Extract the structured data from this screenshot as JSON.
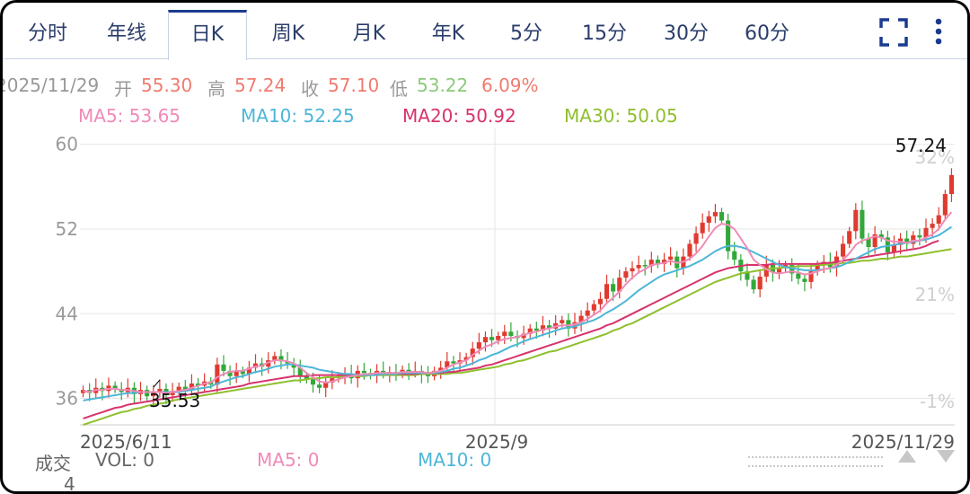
{
  "tabs": [
    "分时",
    "年线",
    "日K",
    "周K",
    "月K",
    "年K",
    "5分",
    "15分",
    "30分",
    "60分"
  ],
  "active_tab": "日K",
  "controls": {
    "fullscreen_icon": "fullscreen-icon",
    "more_icon": "more-vertical-icon"
  },
  "ohlc": {
    "date": "2025/11/29",
    "open_label": "开",
    "open": "55.30",
    "high_label": "高",
    "high": "57.24",
    "close_label": "收",
    "close": "57.10",
    "low_label": "低",
    "low": "53.22",
    "change": "6.09%"
  },
  "ma_legend": [
    {
      "label": "MA5: 53.65",
      "color": "#f08bb8"
    },
    {
      "label": "MA10: 52.25",
      "color": "#4db6d8"
    },
    {
      "label": "MA20: 50.92",
      "color": "#d8336d"
    },
    {
      "label": "MA30: 50.05",
      "color": "#8fbf2e"
    }
  ],
  "volume_legend": {
    "title": "成交",
    "vol": "VOL: 0",
    "ma5": "MA5: 0",
    "ma10": "MA10: 0",
    "axis_value": "4"
  },
  "colors": {
    "up": "#e03a2f",
    "down": "#33a83a",
    "grid": "#e6e6e6",
    "axis_text": "#9a9a9a",
    "tab_text": "#2a3d6b"
  },
  "chart_data": {
    "type": "candlestick",
    "y_ticks": [
      "60",
      "52",
      "44",
      "36"
    ],
    "y_tick_values": [
      60,
      52,
      44,
      36
    ],
    "pct_ticks": [
      "32%",
      "21%",
      "-1%"
    ],
    "pct_tick_values": [
      58.8,
      45.8,
      35.7
    ],
    "x_ticks": [
      "2025/6/11",
      "2025/9",
      "2025/11/29"
    ],
    "ylim": [
      33.5,
      61.5
    ],
    "high_annotation": "57.24",
    "low_annotation": "35.53",
    "closes": [
      36.8,
      36.5,
      37.0,
      36.7,
      37.2,
      36.9,
      36.6,
      37.0,
      36.4,
      36.8,
      36.2,
      36.6,
      36.9,
      36.3,
      36.7,
      37.1,
      36.8,
      37.4,
      37.2,
      37.6,
      37.3,
      39.2,
      38.6,
      38.1,
      38.6,
      38.3,
      38.9,
      39.3,
      39.0,
      39.6,
      40.0,
      39.5,
      39.3,
      38.9,
      38.1,
      37.8,
      37.3,
      37.0,
      37.5,
      37.9,
      38.1,
      38.3,
      37.9,
      38.6,
      38.4,
      38.2,
      38.6,
      38.4,
      38.5,
      38.3,
      38.7,
      38.5,
      38.6,
      38.3,
      38.1,
      38.6,
      38.9,
      39.5,
      39.3,
      39.6,
      39.9,
      40.7,
      41.3,
      41.8,
      41.5,
      41.9,
      42.3,
      41.9,
      41.7,
      42.1,
      42.6,
      42.4,
      42.9,
      42.6,
      43.1,
      43.4,
      42.6,
      43.2,
      43.8,
      44.3,
      44.9,
      45.4,
      46.8,
      46.1,
      47.4,
      48.0,
      48.3,
      48.6,
      48.5,
      49.1,
      48.7,
      49.1,
      49.4,
      48.3,
      49.4,
      50.6,
      51.6,
      52.6,
      53.2,
      53.6,
      52.8,
      49.9,
      49.1,
      48.0,
      47.2,
      46.3,
      47.5,
      48.6,
      47.9,
      48.3,
      48.6,
      47.8,
      47.3,
      47.0,
      48.0,
      48.6,
      48.9,
      48.4,
      49.4,
      50.6,
      51.8,
      53.8,
      51.1,
      50.3,
      51.5,
      51.2,
      49.8,
      50.5,
      51.1,
      50.6,
      51.4,
      51.2,
      52.1,
      52.5,
      53.3,
      55.3,
      57.1
    ],
    "ma5": [
      36.7,
      36.6,
      36.8,
      36.8,
      36.9,
      36.9,
      36.8,
      36.8,
      36.7,
      36.6,
      36.6,
      36.6,
      36.6,
      36.5,
      36.6,
      36.7,
      36.8,
      37.0,
      37.2,
      37.4,
      37.5,
      38.0,
      38.3,
      38.5,
      38.6,
      38.6,
      38.8,
      39.0,
      39.1,
      39.4,
      39.6,
      39.6,
      39.5,
      39.3,
      38.9,
      38.4,
      38.0,
      37.6,
      37.5,
      37.6,
      37.8,
      38.0,
      38.1,
      38.2,
      38.3,
      38.3,
      38.4,
      38.4,
      38.4,
      38.4,
      38.5,
      38.5,
      38.5,
      38.5,
      38.4,
      38.5,
      38.6,
      38.9,
      39.2,
      39.4,
      39.6,
      40.1,
      40.5,
      40.9,
      41.1,
      41.4,
      41.6,
      41.7,
      41.8,
      42.0,
      42.2,
      42.3,
      42.5,
      42.6,
      42.8,
      42.9,
      42.9,
      43.0,
      43.2,
      43.5,
      43.9,
      44.3,
      45.0,
      45.5,
      46.1,
      46.8,
      47.4,
      47.9,
      48.2,
      48.6,
      48.7,
      48.8,
      49.0,
      48.8,
      48.9,
      49.2,
      49.7,
      50.4,
      51.3,
      52.1,
      52.5,
      52.4,
      52.0,
      51.1,
      50.2,
      49.1,
      48.6,
      48.2,
      47.9,
      47.8,
      47.9,
      48.0,
      47.9,
      47.7,
      47.8,
      48.0,
      48.2,
      48.3,
      48.6,
      49.1,
      49.7,
      50.5,
      50.9,
      51.1,
      51.3,
      51.2,
      50.9,
      50.8,
      50.8,
      50.7,
      50.9,
      50.9,
      51.2,
      51.5,
      52.0,
      52.9,
      53.6
    ],
    "ma10": [
      35.8,
      35.9,
      36.0,
      36.1,
      36.2,
      36.3,
      36.4,
      36.5,
      36.5,
      36.6,
      36.6,
      36.6,
      36.6,
      36.6,
      36.6,
      36.6,
      36.7,
      36.8,
      36.9,
      37.0,
      37.1,
      37.4,
      37.6,
      37.8,
      38.0,
      38.1,
      38.3,
      38.5,
      38.6,
      38.8,
      39.0,
      39.1,
      39.2,
      39.2,
      39.1,
      39.0,
      38.9,
      38.7,
      38.6,
      38.5,
      38.4,
      38.3,
      38.3,
      38.2,
      38.2,
      38.2,
      38.2,
      38.3,
      38.3,
      38.3,
      38.4,
      38.4,
      38.4,
      38.4,
      38.4,
      38.4,
      38.5,
      38.6,
      38.8,
      38.9,
      39.1,
      39.3,
      39.6,
      39.8,
      40.1,
      40.3,
      40.6,
      40.9,
      41.1,
      41.4,
      41.6,
      41.8,
      42.0,
      42.2,
      42.4,
      42.6,
      42.7,
      42.8,
      43.0,
      43.2,
      43.4,
      43.7,
      44.1,
      44.4,
      44.8,
      45.2,
      45.7,
      46.2,
      46.6,
      47.0,
      47.4,
      47.7,
      47.9,
      48.1,
      48.3,
      48.5,
      48.8,
      49.1,
      49.5,
      49.9,
      50.2,
      50.4,
      50.4,
      50.3,
      50.1,
      49.8,
      49.5,
      49.2,
      48.9,
      48.6,
      48.4,
      48.3,
      48.2,
      48.1,
      48.1,
      48.1,
      48.2,
      48.3,
      48.4,
      48.6,
      48.9,
      49.2,
      49.5,
      49.8,
      50.1,
      50.3,
      50.4,
      50.5,
      50.6,
      50.7,
      50.8,
      50.9,
      51.0,
      51.2,
      51.4,
      51.8,
      52.2
    ],
    "ma20": [
      34.1,
      34.3,
      34.5,
      34.7,
      34.9,
      35.1,
      35.2,
      35.4,
      35.5,
      35.6,
      35.7,
      35.8,
      35.9,
      36.0,
      36.1,
      36.2,
      36.3,
      36.4,
      36.5,
      36.6,
      36.7,
      36.8,
      36.9,
      37.0,
      37.1,
      37.2,
      37.4,
      37.5,
      37.6,
      37.7,
      37.8,
      37.9,
      38.0,
      38.1,
      38.1,
      38.1,
      38.2,
      38.2,
      38.2,
      38.2,
      38.2,
      38.2,
      38.2,
      38.2,
      38.2,
      38.3,
      38.3,
      38.3,
      38.3,
      38.3,
      38.3,
      38.3,
      38.3,
      38.4,
      38.4,
      38.4,
      38.4,
      38.5,
      38.5,
      38.6,
      38.7,
      38.8,
      38.9,
      39.1,
      39.2,
      39.4,
      39.6,
      39.8,
      40.0,
      40.2,
      40.4,
      40.6,
      40.8,
      41.0,
      41.2,
      41.4,
      41.6,
      41.8,
      42.0,
      42.2,
      42.4,
      42.6,
      42.9,
      43.1,
      43.4,
      43.7,
      44.0,
      44.3,
      44.6,
      44.9,
      45.2,
      45.5,
      45.8,
      46.1,
      46.4,
      46.7,
      47.0,
      47.3,
      47.6,
      47.9,
      48.1,
      48.3,
      48.4,
      48.5,
      48.6,
      48.6,
      48.6,
      48.6,
      48.7,
      48.7,
      48.7,
      48.7,
      48.7,
      48.7,
      48.7,
      48.7,
      48.8,
      48.8,
      48.9,
      49.0,
      49.1,
      49.2,
      49.3,
      49.4,
      49.5,
      49.6,
      49.7,
      49.8,
      49.9,
      50.0,
      50.1,
      50.2,
      50.4,
      50.7,
      50.9
    ],
    "ma30": [
      33.5,
      33.7,
      33.9,
      34.1,
      34.3,
      34.5,
      34.7,
      34.8,
      35.0,
      35.1,
      35.3,
      35.4,
      35.5,
      35.6,
      35.8,
      35.9,
      36.0,
      36.1,
      36.2,
      36.3,
      36.4,
      36.5,
      36.6,
      36.7,
      36.8,
      36.9,
      37.0,
      37.1,
      37.2,
      37.3,
      37.4,
      37.5,
      37.6,
      37.7,
      37.7,
      37.8,
      37.9,
      37.9,
      38.0,
      38.0,
      38.0,
      38.1,
      38.1,
      38.1,
      38.1,
      38.2,
      38.2,
      38.2,
      38.2,
      38.2,
      38.2,
      38.2,
      38.2,
      38.3,
      38.3,
      38.3,
      38.3,
      38.3,
      38.4,
      38.4,
      38.5,
      38.6,
      38.7,
      38.8,
      38.9,
      39.0,
      39.2,
      39.3,
      39.5,
      39.6,
      39.8,
      40.0,
      40.2,
      40.4,
      40.5,
      40.7,
      40.9,
      41.1,
      41.3,
      41.5,
      41.7,
      41.9,
      42.1,
      42.4,
      42.6,
      42.9,
      43.1,
      43.4,
      43.7,
      44.0,
      44.3,
      44.6,
      44.9,
      45.2,
      45.5,
      45.8,
      46.1,
      46.4,
      46.7,
      47.0,
      47.2,
      47.4,
      47.6,
      47.8,
      47.9,
      48.0,
      48.1,
      48.2,
      48.3,
      48.3,
      48.4,
      48.4,
      48.5,
      48.5,
      48.5,
      48.6,
      48.6,
      48.7,
      48.7,
      48.8,
      48.8,
      48.9,
      49.0,
      49.0,
      49.1,
      49.2,
      49.2,
      49.3,
      49.4,
      49.4,
      49.5,
      49.6,
      49.7,
      49.8,
      49.9,
      50.0,
      50.1
    ]
  }
}
